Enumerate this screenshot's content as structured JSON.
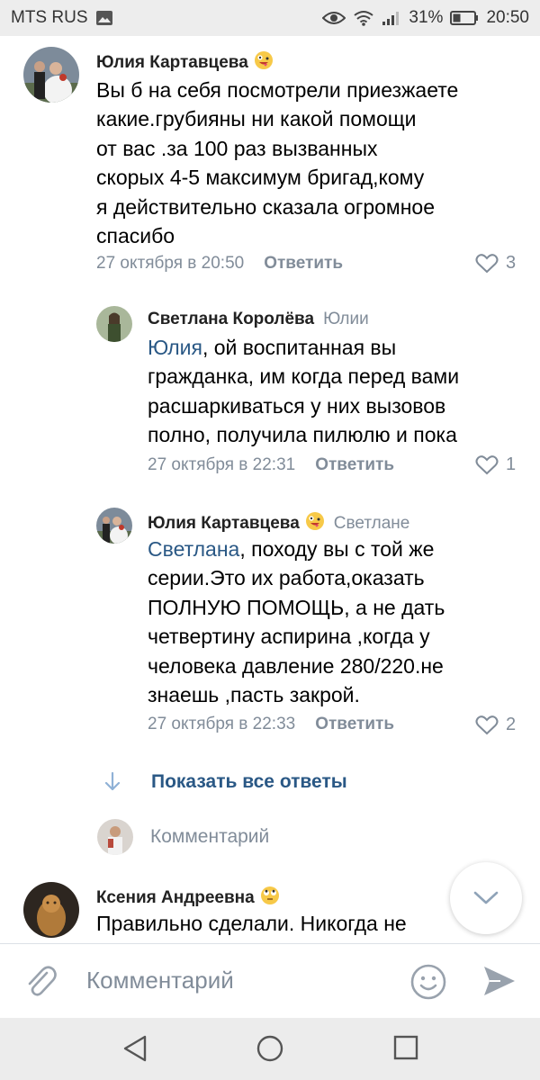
{
  "status_bar": {
    "carrier": "MTS RUS",
    "battery": "31%",
    "time": "20:50"
  },
  "comments": [
    {
      "author": "Юлия Картавцева",
      "author_emoji": "zany-face",
      "text": "Вы б на себя посмотрели приезжаете\nкакие.грубияны ни какой помощи\nот вас .за 100 раз вызванных\nскорых 4-5 максимум бригад,кому\nя действительно сказала огромное\nспасибо",
      "date": "27 октября в 20:50",
      "reply_label": "Ответить",
      "likes": "3"
    },
    {
      "author": "Светлана Королёва",
      "reply_to": "Юлии",
      "mention": "Юлия",
      "text": ", ой воспитанная вы\nгражданка, им когда перед вами\nрасшаркиваться у них вызовов\nполно, получила пилюлю и пока",
      "date": "27 октября в 22:31",
      "reply_label": "Ответить",
      "likes": "1"
    },
    {
      "author": "Юлия Картавцева",
      "author_emoji": "zany-face",
      "reply_to": "Светлане",
      "mention": "Светлана",
      "text": ", походу вы с той же\nсерии.Это их работа,оказать\nПОЛНУЮ ПОМОЩЬ, а не дать\nчетвертину аспирина ,когда у\nчеловека давление 280/220.не\nзнаешь ,пасть закрой.",
      "date": "27 октября в 22:33",
      "reply_label": "Ответить",
      "likes": "2"
    },
    {
      "author": "Ксения Андреевна",
      "author_emoji": "rolling-eyes-face",
      "text": "Правильно сделали. Никогда не"
    }
  ],
  "show_all_replies": "Показать все ответы",
  "reply_field_placeholder": "Комментарий",
  "composer": {
    "placeholder": "Комментарий"
  },
  "colors": {
    "link": "#2a5885",
    "secondary": "#818c99",
    "send_arrow": "#99a2ad"
  }
}
